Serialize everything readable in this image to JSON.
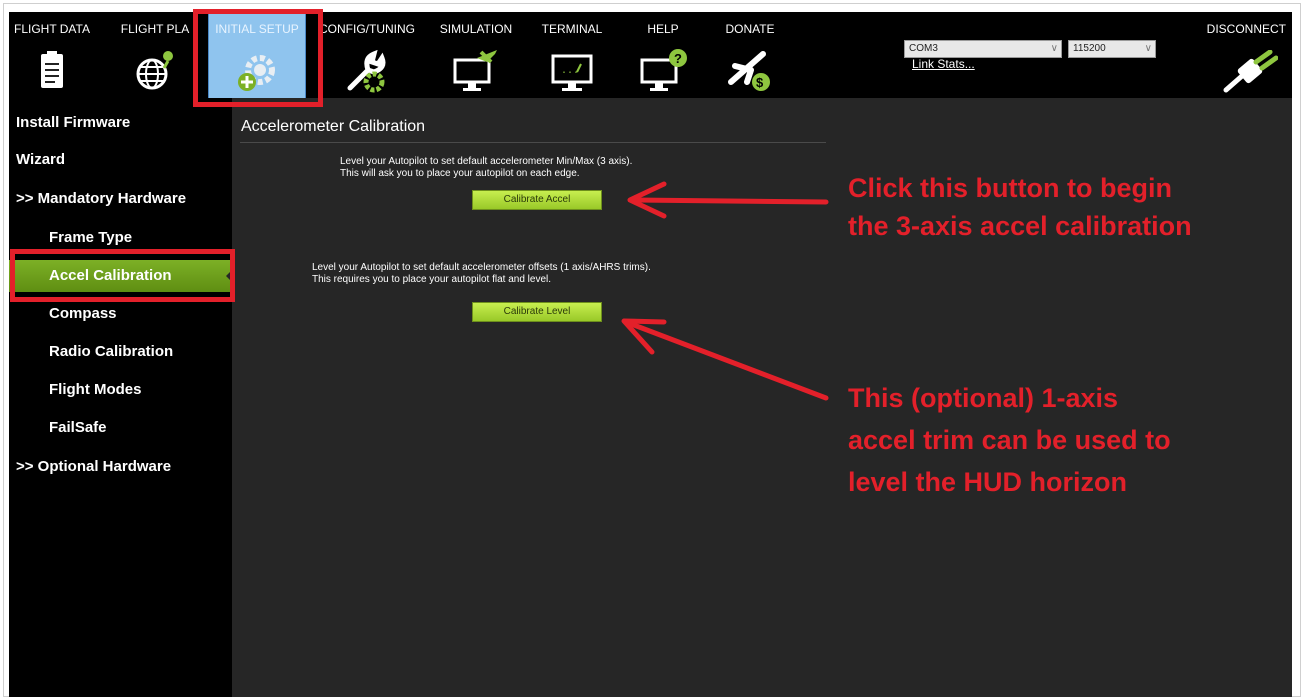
{
  "toolbar": {
    "items": [
      {
        "label": "FLIGHT DATA",
        "icon": "clipboard-icon"
      },
      {
        "label": "FLIGHT PLA",
        "icon": "globe-icon"
      },
      {
        "label": "INITIAL SETUP",
        "icon": "gear-plus-icon"
      },
      {
        "label": "CONFIG/TUNING",
        "icon": "wrench-gear-icon"
      },
      {
        "label": "SIMULATION",
        "icon": "monitor-plane-icon"
      },
      {
        "label": "TERMINAL",
        "icon": "monitor-terminal-icon"
      },
      {
        "label": "HELP",
        "icon": "monitor-help-icon"
      },
      {
        "label": "DONATE",
        "icon": "plane-dollar-icon"
      }
    ],
    "port": "COM3",
    "baud": "115200",
    "link_stats": "Link Stats...",
    "disconnect": "DISCONNECT"
  },
  "sidebar": {
    "items": [
      {
        "label": "Install Firmware"
      },
      {
        "label": "Wizard"
      },
      {
        "label": ">> Mandatory Hardware"
      },
      {
        "label": "Frame Type"
      },
      {
        "label": "Accel Calibration"
      },
      {
        "label": "Compass"
      },
      {
        "label": "Radio Calibration"
      },
      {
        "label": "Flight Modes"
      },
      {
        "label": "FailSafe"
      },
      {
        "label": ">> Optional Hardware"
      }
    ]
  },
  "main": {
    "title": "Accelerometer Calibration",
    "desc1": "Level your Autopilot to set default accelerometer Min/Max (3 axis).\nThis will ask you to place your autopilot on each edge.",
    "button1": "Calibrate Accel",
    "desc2": "Level your Autopilot to set default accelerometer offsets (1 axis/AHRS trims).\nThis requires you to place your autopilot flat and level.",
    "button2": "Calibrate Level"
  },
  "annotations": {
    "note1_line1": "Click this button to begin",
    "note1_line2": "the 3-axis accel calibration",
    "note2_line1": "This (optional) 1-axis",
    "note2_line2": "accel trim can be used to",
    "note2_line3": "level the HUD horizon",
    "color": "#e3202a"
  },
  "colors": {
    "accent_green": "#7cb026",
    "button_green": "#b2dd3c",
    "panel_dark": "#262626",
    "active_tab": "#8fc4ee"
  }
}
